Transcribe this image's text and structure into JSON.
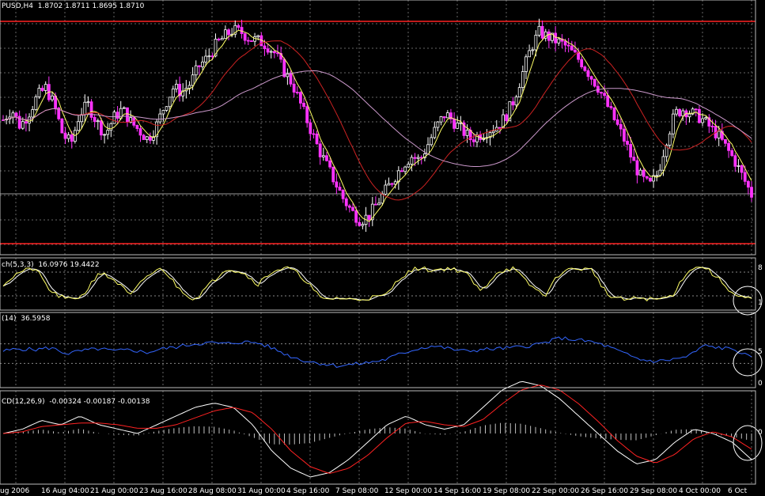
{
  "main_header": {
    "symbol_tf": "PUSD,H4",
    "ohlc": "1.8702 1.8711 1.8695 1.8710"
  },
  "stoch_header": {
    "name": "ch(5,3,3)",
    "values": "16.0976 19.4422"
  },
  "rsi_header": {
    "name": "(14)",
    "values": "36.5958"
  },
  "macd_header": {
    "name": "CD(12,26,9)",
    "values": "-0.00324 -0.00187 -0.00138"
  },
  "right_axis": {
    "stoch_top": "8",
    "stoch_bottom": "1",
    "rsi_top": "5",
    "rsi_bottom": "0",
    "macd_zero": "0"
  },
  "colors": {
    "bull_candle": "#ffffff",
    "bear_candle": "#ff33ff",
    "ma_fast": "#ffff66",
    "ma_mid": "#cc2222",
    "ma_slow": "#cc99cc",
    "stoch_main": "#ffff66",
    "stoch_signal": "#ffffff",
    "rsi": "#3366ff",
    "macd_line": "#ffffff",
    "macd_signal": "#ff2222",
    "macd_hist": "#c0c0c0",
    "level_red": "#ff2222",
    "grid": "#666666"
  },
  "chart_data": {
    "type": "candlestick",
    "x_labels": [
      "ug 2006",
      "16 Aug 04:00",
      "21 Aug 00:00",
      "23 Aug 16:00",
      "28 Aug 08:00",
      "31 Aug 00:00",
      "4 Sep 16:00",
      "7 Sep 08:00",
      "12 Sep 00:00",
      "14 Sep 16:00",
      "19 Sep 08:00",
      "22 Sep 00:00",
      "26 Sep 16:00",
      "29 Sep 08:00",
      "4 Oct 00:00",
      "6 Oct"
    ],
    "price_path": [
      0.55,
      0.6,
      0.52,
      0.58,
      0.66,
      0.7,
      0.62,
      0.48,
      0.44,
      0.58,
      0.62,
      0.54,
      0.48,
      0.56,
      0.6,
      0.54,
      0.5,
      0.46,
      0.52,
      0.62,
      0.7,
      0.68,
      0.72,
      0.8,
      0.84,
      0.9,
      0.94,
      0.97,
      0.96,
      0.93,
      0.92,
      0.9,
      0.86,
      0.78,
      0.72,
      0.62,
      0.52,
      0.42,
      0.34,
      0.26,
      0.18,
      0.12,
      0.08,
      0.1,
      0.16,
      0.22,
      0.28,
      0.34,
      0.38,
      0.36,
      0.44,
      0.52,
      0.58,
      0.54,
      0.5,
      0.46,
      0.48,
      0.5,
      0.52,
      0.56,
      0.64,
      0.76,
      0.88,
      0.96,
      0.94,
      0.92,
      0.9,
      0.86,
      0.82,
      0.76,
      0.7,
      0.62,
      0.54,
      0.46,
      0.36,
      0.28,
      0.24,
      0.3,
      0.46,
      0.58,
      0.6,
      0.58,
      0.56,
      0.52,
      0.48,
      0.42,
      0.36,
      0.28,
      0.2
    ],
    "stoch_path": [
      0.5,
      0.8,
      0.9,
      0.3,
      0.1,
      0.2,
      0.8,
      0.6,
      0.2,
      0.7,
      0.9,
      0.4,
      0.1,
      0.5,
      0.9,
      0.8,
      0.5,
      0.85,
      0.9,
      0.6,
      0.1,
      0.15,
      0.1,
      0.15,
      0.2,
      0.7,
      0.9,
      0.85,
      0.9,
      0.8,
      0.3,
      0.8,
      0.9,
      0.5,
      0.2,
      0.8,
      0.9,
      0.85,
      0.2,
      0.1,
      0.15,
      0.1,
      0.2,
      0.85,
      0.95,
      0.6,
      0.2,
      0.1
    ],
    "rsi_path": [
      0.55,
      0.6,
      0.58,
      0.62,
      0.5,
      0.56,
      0.6,
      0.55,
      0.58,
      0.52,
      0.6,
      0.64,
      0.7,
      0.72,
      0.7,
      0.74,
      0.72,
      0.6,
      0.45,
      0.35,
      0.3,
      0.25,
      0.28,
      0.32,
      0.38,
      0.5,
      0.6,
      0.66,
      0.6,
      0.55,
      0.58,
      0.6,
      0.62,
      0.66,
      0.72,
      0.82,
      0.78,
      0.74,
      0.64,
      0.5,
      0.38,
      0.34,
      0.38,
      0.44,
      0.66,
      0.62,
      0.58,
      0.4
    ],
    "macd_path": [
      0.0,
      0.05,
      0.15,
      0.1,
      0.2,
      0.1,
      0.05,
      0.0,
      0.1,
      0.2,
      0.3,
      0.35,
      0.3,
      0.1,
      -0.2,
      -0.4,
      -0.5,
      -0.45,
      -0.3,
      -0.1,
      0.1,
      0.2,
      0.1,
      0.05,
      0.1,
      0.3,
      0.5,
      0.6,
      0.55,
      0.4,
      0.2,
      0.0,
      -0.2,
      -0.35,
      -0.3,
      -0.1,
      0.05,
      0.0,
      -0.1,
      -0.3
    ],
    "signal_path": [
      0.0,
      0.02,
      0.08,
      0.1,
      0.12,
      0.12,
      0.1,
      0.06,
      0.06,
      0.1,
      0.18,
      0.26,
      0.3,
      0.24,
      0.05,
      -0.2,
      -0.38,
      -0.46,
      -0.4,
      -0.25,
      -0.05,
      0.12,
      0.14,
      0.1,
      0.08,
      0.16,
      0.34,
      0.5,
      0.56,
      0.5,
      0.34,
      0.14,
      -0.08,
      -0.26,
      -0.34,
      -0.24,
      -0.06,
      0.02,
      -0.04,
      -0.18
    ]
  }
}
